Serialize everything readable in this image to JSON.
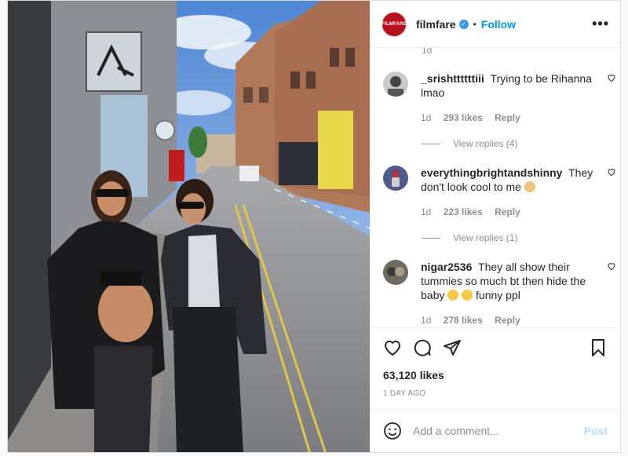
{
  "post": {
    "account": "filmfare",
    "logo_text": "FILMFARE",
    "follow_label": "Follow",
    "separator": "•",
    "more_label": "•••"
  },
  "comments_cutoff": "1d",
  "comments": [
    {
      "username": "_srishttttttiii",
      "text": "Trying to be Rihanna lmao",
      "age": "1d",
      "likes": "293 likes",
      "reply": "Reply",
      "replies": "View replies (4)"
    },
    {
      "username": "everythingbrightandshinny",
      "text": "They don't look cool to me",
      "age": "1d",
      "likes": "223 likes",
      "reply": "Reply",
      "replies": "View replies (1)"
    },
    {
      "username": "nigar2536",
      "text": "They all show their tummies so much bt then hide the baby",
      "text_suffix": "funny ppl",
      "age": "1d",
      "likes": "278 likes",
      "reply": "Reply"
    }
  ],
  "engagement": {
    "likes": "63,120 likes",
    "date": "1 DAY AGO"
  },
  "composer": {
    "placeholder": "Add a comment...",
    "post_label": "Post"
  },
  "colors": {
    "brand_red": "#b5121b",
    "link_blue": "#0095f6",
    "muted": "#8e8e8e",
    "post_disabled": "#b2dffc"
  }
}
